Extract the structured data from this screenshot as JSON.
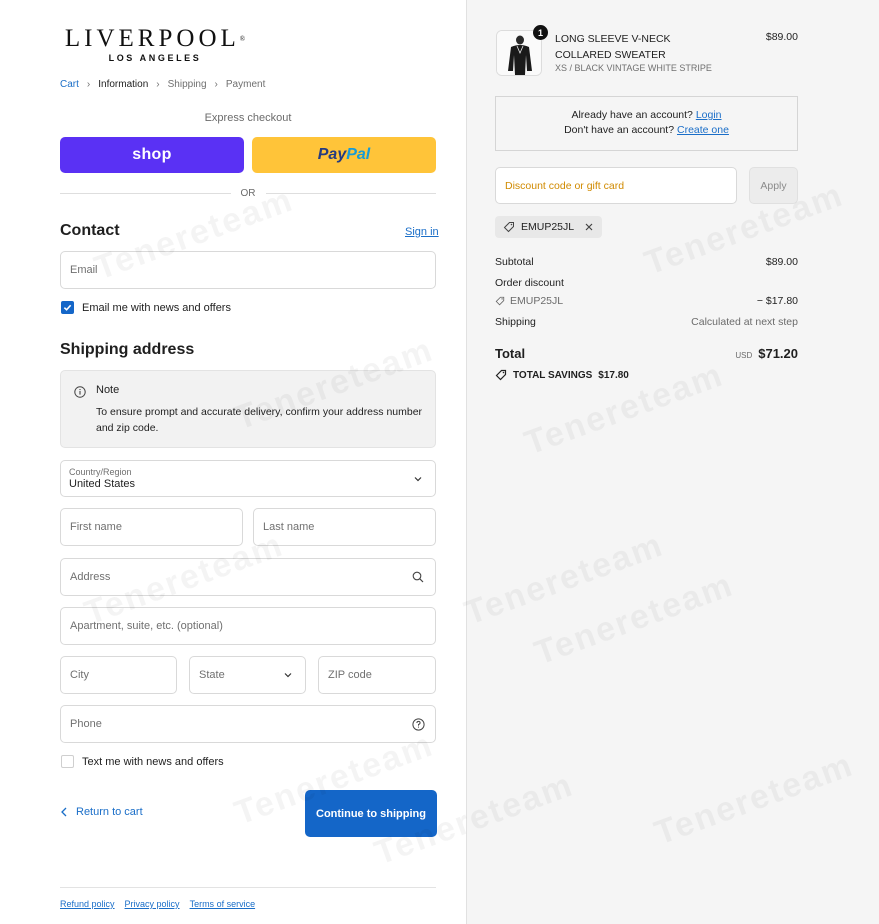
{
  "brand": {
    "name": "LIVERPOOL",
    "trademark": "®",
    "sub": "LOS ANGELES"
  },
  "breadcrumb": [
    "Cart",
    "Information",
    "Shipping",
    "Payment"
  ],
  "express": {
    "label": "Express checkout",
    "shop": "shop",
    "paypal_a": "Pay",
    "paypal_b": "Pal",
    "or": "OR"
  },
  "contact": {
    "title": "Contact",
    "signin": "Sign in",
    "email_placeholder": "Email",
    "newsletter_label": "Email me with news and offers",
    "newsletter_checked": true
  },
  "shipping": {
    "title": "Shipping address",
    "note_title": "Note",
    "note_body": "To ensure prompt and accurate delivery, confirm your address number and zip code.",
    "country_label": "Country/Region",
    "country_value": "United States",
    "first_name": "First name",
    "last_name": "Last name",
    "address": "Address",
    "apartment": "Apartment, suite, etc. (optional)",
    "city": "City",
    "state": "State",
    "zip": "ZIP code",
    "phone": "Phone",
    "sms_label": "Text me with news and offers",
    "sms_checked": false
  },
  "actions": {
    "return": "Return to cart",
    "continue": "Continue to shipping"
  },
  "footer": [
    "Refund policy",
    "Privacy policy",
    "Terms of service"
  ],
  "order": {
    "item": {
      "name": "LONG SLEEVE V-NECK COLLARED SWEATER",
      "variant": "XS / BLACK VINTAGE WHITE STRIPE",
      "price": "$89.00",
      "quantity": "1"
    },
    "account": {
      "line1_text": "Already have an account?",
      "line1_link": "Login",
      "line2_text": "Don't have an account?",
      "line2_link": "Create one"
    },
    "discount_placeholder": "Discount code or gift card",
    "apply": "Apply",
    "applied_code": "EMUP25JL",
    "subtotal_label": "Subtotal",
    "subtotal": "$89.00",
    "order_discount_label": "Order discount",
    "discount_code": "EMUP25JL",
    "discount_amount": "− $17.80",
    "shipping_label": "Shipping",
    "shipping_value": "Calculated at next step",
    "total_label": "Total",
    "currency": "USD",
    "total": "$71.20",
    "savings_label": "TOTAL SAVINGS",
    "savings": "$17.80"
  },
  "watermark": "Tenereteam",
  "colors": {
    "primary": "#1466c8",
    "shop": "#5a31f4",
    "paypal": "#ffc439",
    "link": "#1a6ec8"
  }
}
